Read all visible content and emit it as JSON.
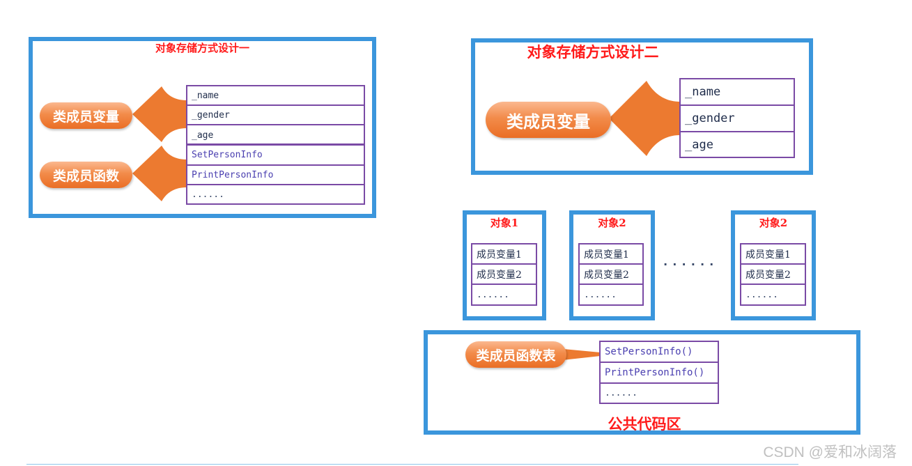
{
  "design1": {
    "title": "对象存储方式设计一",
    "member_vars_label": "类成员变量",
    "member_funcs_label": "类成员函数",
    "vars": [
      "_name",
      "_gender",
      "_age"
    ],
    "funcs": [
      "SetPersonInfo",
      "PrintPersonInfo",
      "......"
    ]
  },
  "design2": {
    "title": "对象存储方式设计二",
    "member_vars_label": "类成员变量",
    "vars": [
      "_name",
      "_gender",
      "_age"
    ],
    "objects": [
      {
        "title": "对象1",
        "rows": [
          "成员变量1",
          "成员变量2",
          "......"
        ]
      },
      {
        "title": "对象2",
        "rows": [
          "成员变量1",
          "成员变量2",
          "......"
        ]
      },
      {
        "title": "对象2",
        "rows": [
          "成员变量1",
          "成员变量2",
          "......"
        ]
      }
    ],
    "ellipsis": "......",
    "func_table_label": "类成员函数表",
    "funcs": [
      "SetPersonInfo()",
      "PrintPersonInfo()",
      "......"
    ],
    "code_area_label": "公共代码区"
  },
  "watermark": "CSDN @爱和冰阔落",
  "colors": {
    "panel_border": "#3b96dc",
    "title": "#ff1a1a",
    "table_border": "#7a4aa5",
    "pill": "#ea6e25",
    "arrow": "#ec7a30"
  }
}
